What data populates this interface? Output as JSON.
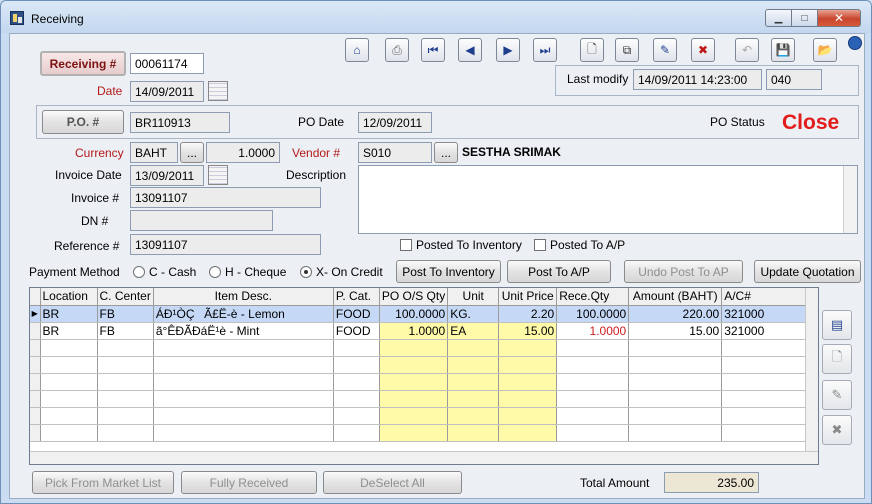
{
  "window": {
    "title": "Receiving"
  },
  "window_buttons": {
    "minimize": "▁",
    "maximize": "□",
    "close": "✕"
  },
  "toolbar": {
    "home": "⌂",
    "print": "⎙",
    "first": "⏮",
    "prev": "◀",
    "next": "▶",
    "last": "⏭",
    "new": "🗋",
    "copy": "⧉",
    "edit": "✎",
    "delete": "✖",
    "undo": "↶",
    "save": "💾",
    "folder": "📂"
  },
  "header": {
    "receiving_button": "Receiving #",
    "receiving_no": "00061174",
    "date_label": "Date",
    "date": "14/09/2011",
    "last_modify_label": "Last modify",
    "last_modify": "14/09/2011 14:23:00",
    "user_code": "040"
  },
  "po": {
    "po_button": "P.O. #",
    "po_no": "BR110913",
    "po_date_label": "PO Date",
    "po_date": "12/09/2011",
    "po_status_label": "PO Status",
    "po_status": "Close",
    "currency_label": "Currency",
    "currency": "BAHT",
    "ellipsis": "...",
    "rate": "1.0000",
    "vendor_label": "Vendor #",
    "vendor_code": "S010",
    "vendor_name": "SESTHA  SRIMAK",
    "invoice_date_label": "Invoice Date",
    "invoice_date": "13/09/2011",
    "description_label": "Description",
    "description": "",
    "invoice_label": "Invoice #",
    "invoice_no": "13091107",
    "dn_label": "DN #",
    "dn_no": "",
    "reference_label": "Reference #",
    "reference": "13091107",
    "posted_inventory": "Posted To Inventory",
    "posted_ap": "Posted To A/P"
  },
  "payment": {
    "label": "Payment Method",
    "options": [
      "C - Cash",
      "H - Cheque",
      "X- On Credit"
    ],
    "selected": 2
  },
  "actions": {
    "post_inventory": "Post To Inventory",
    "post_ap": "Post To A/P",
    "undo_post_ap": "Undo Post To AP",
    "update_quotation": "Update Quotation"
  },
  "grid": {
    "columns": [
      "Location",
      "C. Center",
      "Item Desc.",
      "P. Cat.",
      "PO O/S Qty",
      "Unit",
      "Unit Price",
      "Rece.Qty",
      "Amount (BAHT)",
      "A/C#"
    ],
    "rows": [
      [
        "BR",
        "FB",
        "ÁÐ¹ÒÇÃ£Ë-è - Lemon",
        "FOOD",
        "100.0000",
        "KG.",
        "2.20",
        "100.0000",
        "220.00",
        "321000"
      ],
      [
        "BR",
        "FB",
        "ã°ÊÐÃÐáË¹è - Mint",
        "FOOD",
        "1.0000",
        "EA",
        "15.00",
        "1.0000",
        "15.00",
        "321000"
      ]
    ]
  },
  "footer": {
    "pick_market": "Pick From Market List",
    "fully_received": "Fully Received",
    "deselect_all": "DeSelect All",
    "total_label": "Total Amount",
    "total_value": "235.00"
  }
}
